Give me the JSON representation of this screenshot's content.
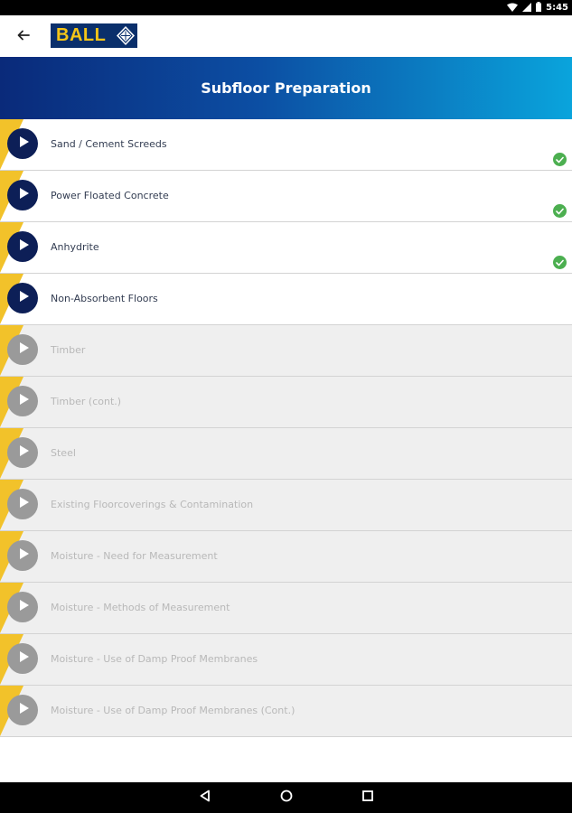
{
  "status_bar": {
    "time": "5:45"
  },
  "app_bar": {
    "logo_text": "BALL"
  },
  "banner": {
    "title": "Subfloor Preparation"
  },
  "items": [
    {
      "label": "Sand / Cement Screeds",
      "state": "unlocked",
      "completed": true
    },
    {
      "label": "Power Floated Concrete",
      "state": "unlocked",
      "completed": true
    },
    {
      "label": "Anhydrite",
      "state": "unlocked",
      "completed": true
    },
    {
      "label": "Non-Absorbent Floors",
      "state": "unlocked",
      "completed": false
    },
    {
      "label": "Timber",
      "state": "locked",
      "completed": false
    },
    {
      "label": "Timber (cont.)",
      "state": "locked",
      "completed": false
    },
    {
      "label": "Steel",
      "state": "locked",
      "completed": false
    },
    {
      "label": "Existing Floorcoverings & Contamination",
      "state": "locked",
      "completed": false
    },
    {
      "label": "Moisture - Need for Measurement",
      "state": "locked",
      "completed": false
    },
    {
      "label": "Moisture - Methods of Measurement",
      "state": "locked",
      "completed": false
    },
    {
      "label": "Moisture - Use of Damp Proof Membranes",
      "state": "locked",
      "completed": false
    },
    {
      "label": "Moisture - Use of Damp Proof Membranes (Cont.)",
      "state": "locked",
      "completed": false
    }
  ],
  "icons": {
    "back": "arrow-back-icon",
    "play": "play-icon",
    "check": "check-circle-icon",
    "nav_back": "nav-back-icon",
    "nav_home": "nav-home-icon",
    "nav_recents": "nav-recents-icon"
  },
  "colors": {
    "brand_navy": "#0d1f57",
    "brand_yellow": "#f2c22a",
    "banner_start": "#0a2a7a",
    "banner_end": "#0aa4dc",
    "complete_green": "#4caf50",
    "locked_bg": "#efefef"
  }
}
